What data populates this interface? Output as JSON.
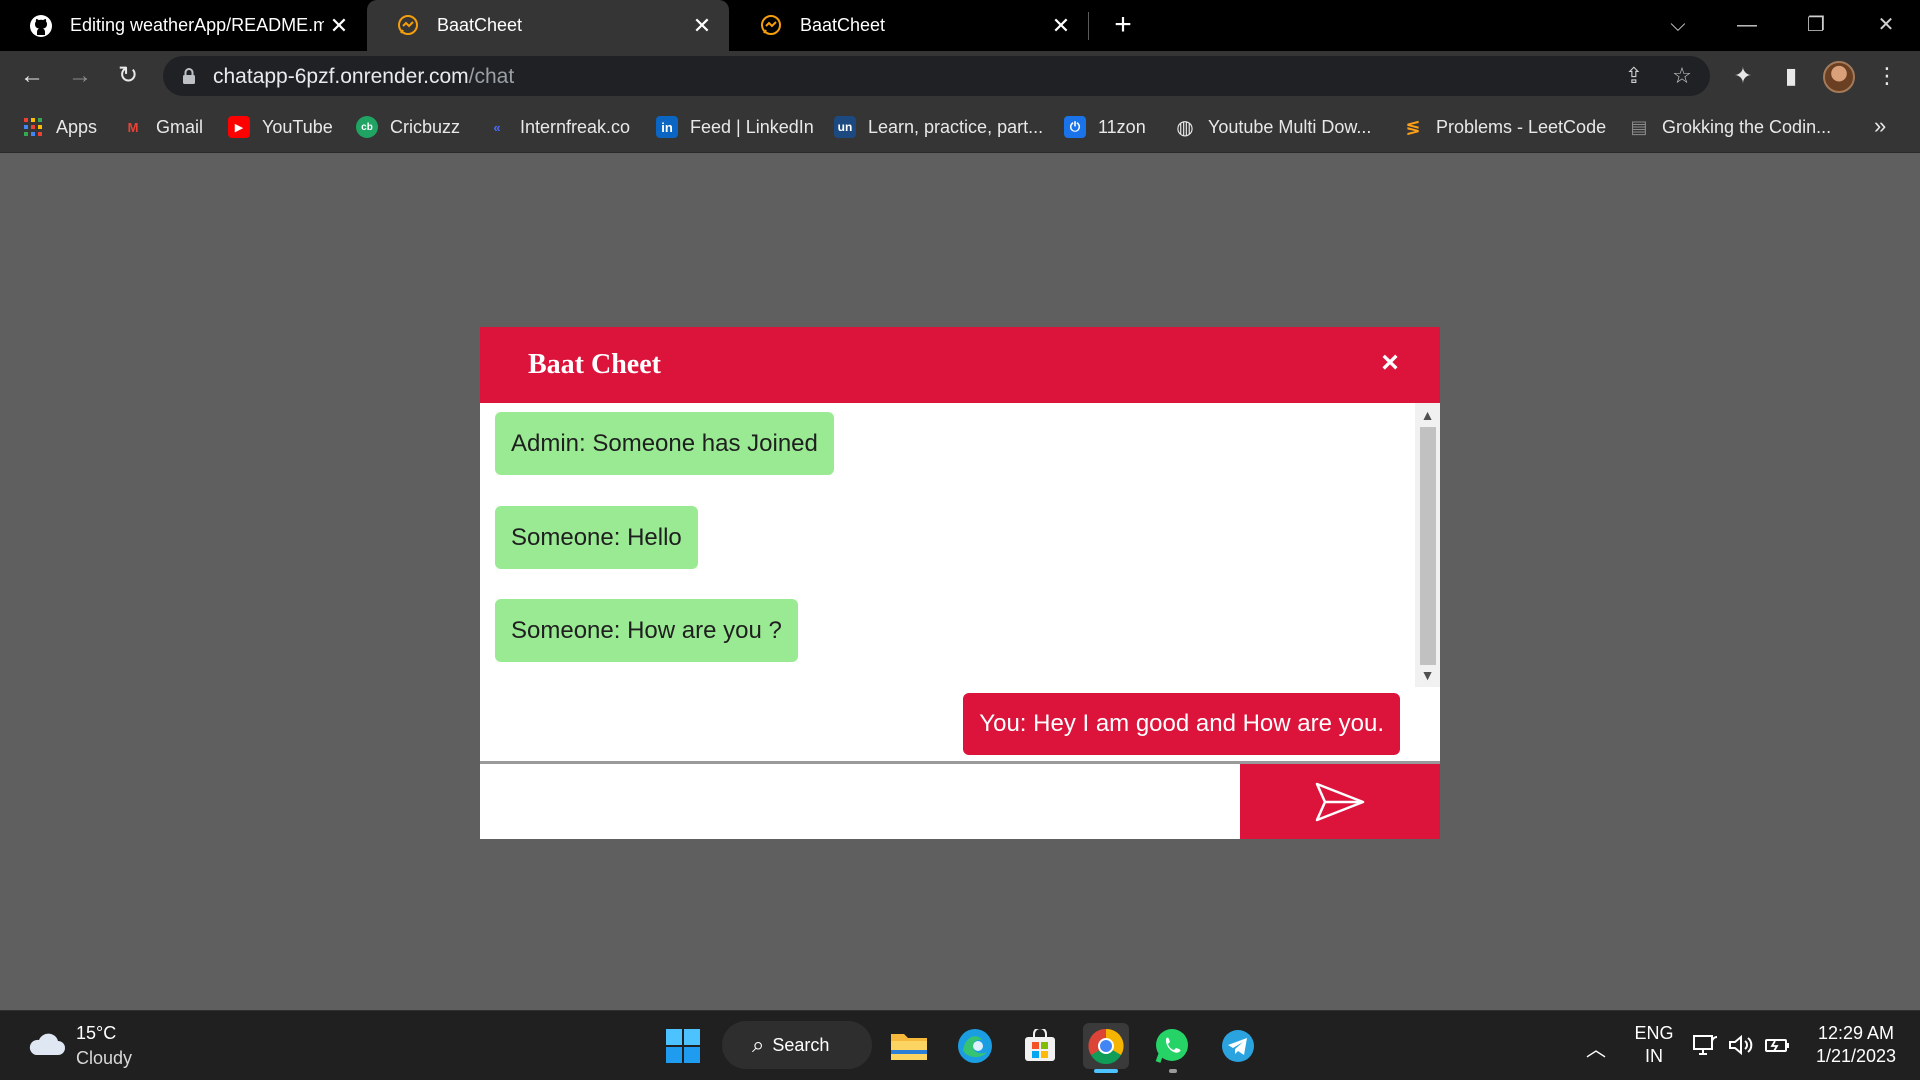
{
  "browser": {
    "tabs": [
      {
        "title": "Editing weatherApp/README.md",
        "icon": "github-icon",
        "close": "✕"
      },
      {
        "title": "BaatCheet",
        "icon": "chat-bubble-icon",
        "close": "✕"
      },
      {
        "title": "BaatCheet",
        "icon": "chat-bubble-icon",
        "close": "✕"
      }
    ],
    "new_tab": "+",
    "window_controls": {
      "dropdown": "⌵",
      "minimize": "—",
      "restore": "❐",
      "close": "✕"
    },
    "address": {
      "host": "chatapp-6pzf.onrender.com",
      "path": "/chat"
    },
    "nav": {
      "back": "←",
      "forward": "→",
      "reload": "↻"
    },
    "toolbar_icons": {
      "share": "⇪",
      "star": "☆",
      "extensions": "✦",
      "sidepanel": "▮",
      "menu": "⋮"
    },
    "bookmarks": [
      {
        "label": "Apps",
        "icon": "apps-grid-icon"
      },
      {
        "label": "Gmail",
        "icon": "gmail-icon",
        "glyph": "M",
        "color": "#ea4335"
      },
      {
        "label": "YouTube",
        "icon": "youtube-icon",
        "glyph": "▶",
        "color": "#ff0000"
      },
      {
        "label": "Cricbuzz",
        "icon": "cricbuzz-icon",
        "glyph": "cb",
        "color": "#1fa463"
      },
      {
        "label": "Internfreak.co",
        "icon": "internfreak-icon",
        "glyph": "«",
        "color": "#4a6cf7"
      },
      {
        "label": "Feed | LinkedIn",
        "icon": "linkedin-icon",
        "glyph": "in",
        "color": "#0a66c2"
      },
      {
        "label": "Learn, practice, part...",
        "icon": "unstop-icon",
        "glyph": "un",
        "color": "#1c4980"
      },
      {
        "label": "11zon",
        "icon": "11zon-icon",
        "glyph": "⏻",
        "color": "#1a73e8"
      },
      {
        "label": "Youtube Multi Dow...",
        "icon": "globe-icon",
        "glyph": "◍",
        "color": "#e8e8e8"
      },
      {
        "label": "Problems - LeetCode",
        "icon": "leetcode-icon",
        "glyph": "≶",
        "color": "#ffa116"
      },
      {
        "label": "Grokking the Codin...",
        "icon": "grokking-icon",
        "glyph": "▤",
        "color": "#6b6b6b"
      }
    ],
    "bookmarks_more": "»"
  },
  "chat": {
    "title": "Baat Cheet",
    "close": "×",
    "messages": [
      {
        "text": "Admin: Someone has Joined",
        "side": "in"
      },
      {
        "text": "Someone: Hello",
        "side": "in"
      },
      {
        "text": "Someone: How are you ?",
        "side": "in"
      },
      {
        "text": "You: Hey I am good and How are you.",
        "side": "out"
      }
    ],
    "input": {
      "value": "",
      "placeholder": ""
    },
    "scroll_up": "▲",
    "scroll_down": "▼",
    "colors": {
      "accent": "#dc143c",
      "incoming": "#99ea93"
    }
  },
  "taskbar": {
    "weather": {
      "temp": "15°C",
      "condition": "Cloudy"
    },
    "search_label": "Search",
    "language": {
      "line1": "ENG",
      "line2": "IN"
    },
    "clock": {
      "time": "12:29 AM",
      "date": "1/21/2023"
    },
    "tray_chevron": "︿"
  }
}
